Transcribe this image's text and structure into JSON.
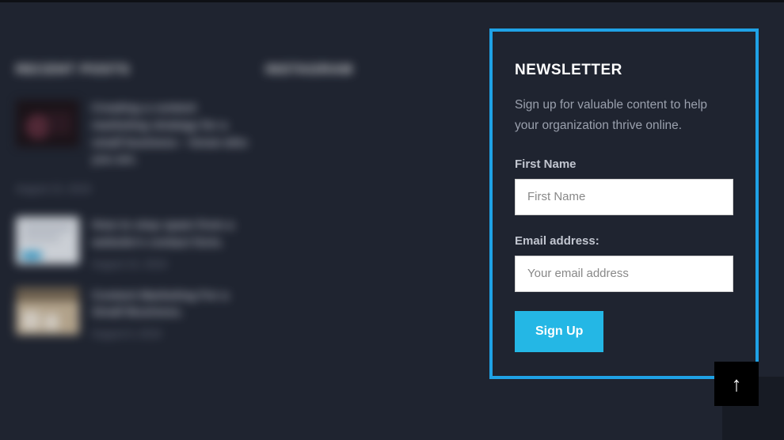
{
  "recent_posts": {
    "heading": "RECENT POSTS",
    "items": [
      {
        "title": "Creating a content marketing strategy for a small business – know who you are.",
        "date": "August 15, 2019"
      },
      {
        "title": "How to stop spam from a website's contact form.",
        "date": "August 10, 2019"
      },
      {
        "title": "Content Marketing For a Small Business.",
        "date": "August 9, 2019"
      }
    ]
  },
  "instagram": {
    "heading": "INSTAGRAM"
  },
  "newsletter": {
    "heading": "NEWSLETTER",
    "description": "Sign up for valuable content to help your organization thrive online.",
    "first_name_label": "First Name",
    "first_name_placeholder": "First Name",
    "email_label": "Email address:",
    "email_placeholder": "Your email address",
    "submit_label": "Sign Up"
  },
  "scroll_top_glyph": "↑"
}
